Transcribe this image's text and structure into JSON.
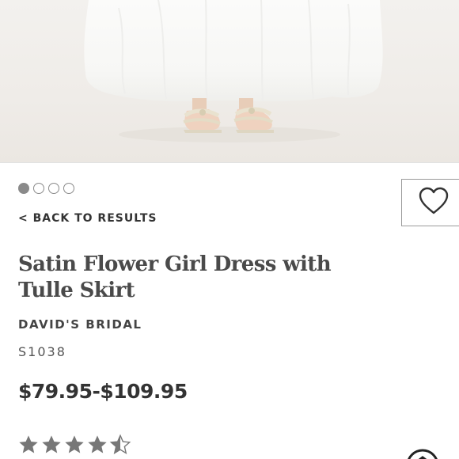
{
  "product": {
    "back_label": "< BACK TO RESULTS",
    "title": "Satin Flower Girl Dress with Tulle Skirt",
    "brand": "DAVID'S BRIDAL",
    "sku": "S1038",
    "price": "$79.95-$109.95",
    "rating": 4.5,
    "rating_max": 5
  },
  "gallery": {
    "image_count": 4,
    "active_index": 0
  },
  "icons": {
    "favorite": "heart-icon",
    "star": "star-icon",
    "chat": "chat-icon"
  },
  "colors": {
    "text": "#333333",
    "dot_fill": "#8a8a8a",
    "star": "#777777"
  }
}
